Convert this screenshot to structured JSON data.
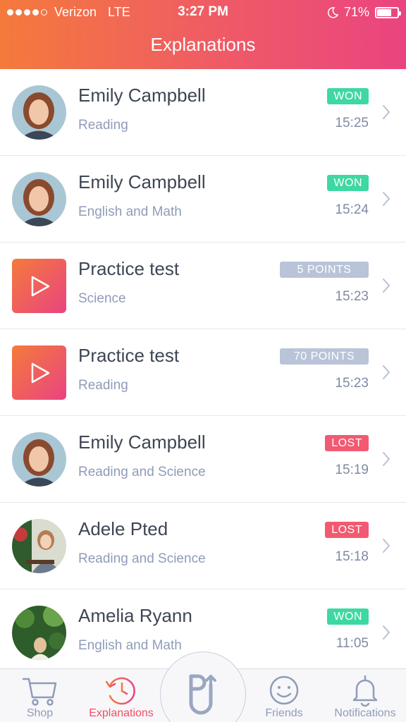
{
  "status_bar": {
    "carrier": "Verizon",
    "network": "LTE",
    "time": "3:27 PM",
    "battery": "71%",
    "battery_level": 0.71
  },
  "header": {
    "title": "Explanations"
  },
  "list": [
    {
      "name": "Emily Campbell",
      "subject": "Reading",
      "badge": "WON",
      "badge_type": "won",
      "time": "15:25",
      "thumb": "avatar-emily"
    },
    {
      "name": "Emily Campbell",
      "subject": "English and Math",
      "badge": "WON",
      "badge_type": "won",
      "time": "15:24",
      "thumb": "avatar-emily"
    },
    {
      "name": "Practice test",
      "subject": "Science",
      "badge": "5 POINTS",
      "badge_type": "points",
      "time": "15:23",
      "thumb": "play-icon"
    },
    {
      "name": "Practice test",
      "subject": "Reading",
      "badge": "70 POINTS",
      "badge_type": "points",
      "time": "15:23",
      "thumb": "play-icon"
    },
    {
      "name": "Emily Campbell",
      "subject": "Reading and Science",
      "badge": "LOST",
      "badge_type": "lost",
      "time": "15:19",
      "thumb": "avatar-emily"
    },
    {
      "name": "Adele Pted",
      "subject": "Reading and Science",
      "badge": "LOST",
      "badge_type": "lost",
      "time": "15:18",
      "thumb": "avatar-adele"
    },
    {
      "name": "Amelia Ryann",
      "subject": "English and Math",
      "badge": "WON",
      "badge_type": "won",
      "time": "11:05",
      "thumb": "avatar-amelia"
    }
  ],
  "tabbar": {
    "shop": "Shop",
    "explanations": "Explanations",
    "friends": "Friends",
    "notifications": "Notifications"
  },
  "colors": {
    "header_start": "#f47a3c",
    "header_end": "#ea4480",
    "won": "#3ed8a2",
    "lost": "#f15a70",
    "points": "#b9c4d9",
    "active_tab": "#ef4e68",
    "inactive_tab": "#8f9cb8"
  }
}
